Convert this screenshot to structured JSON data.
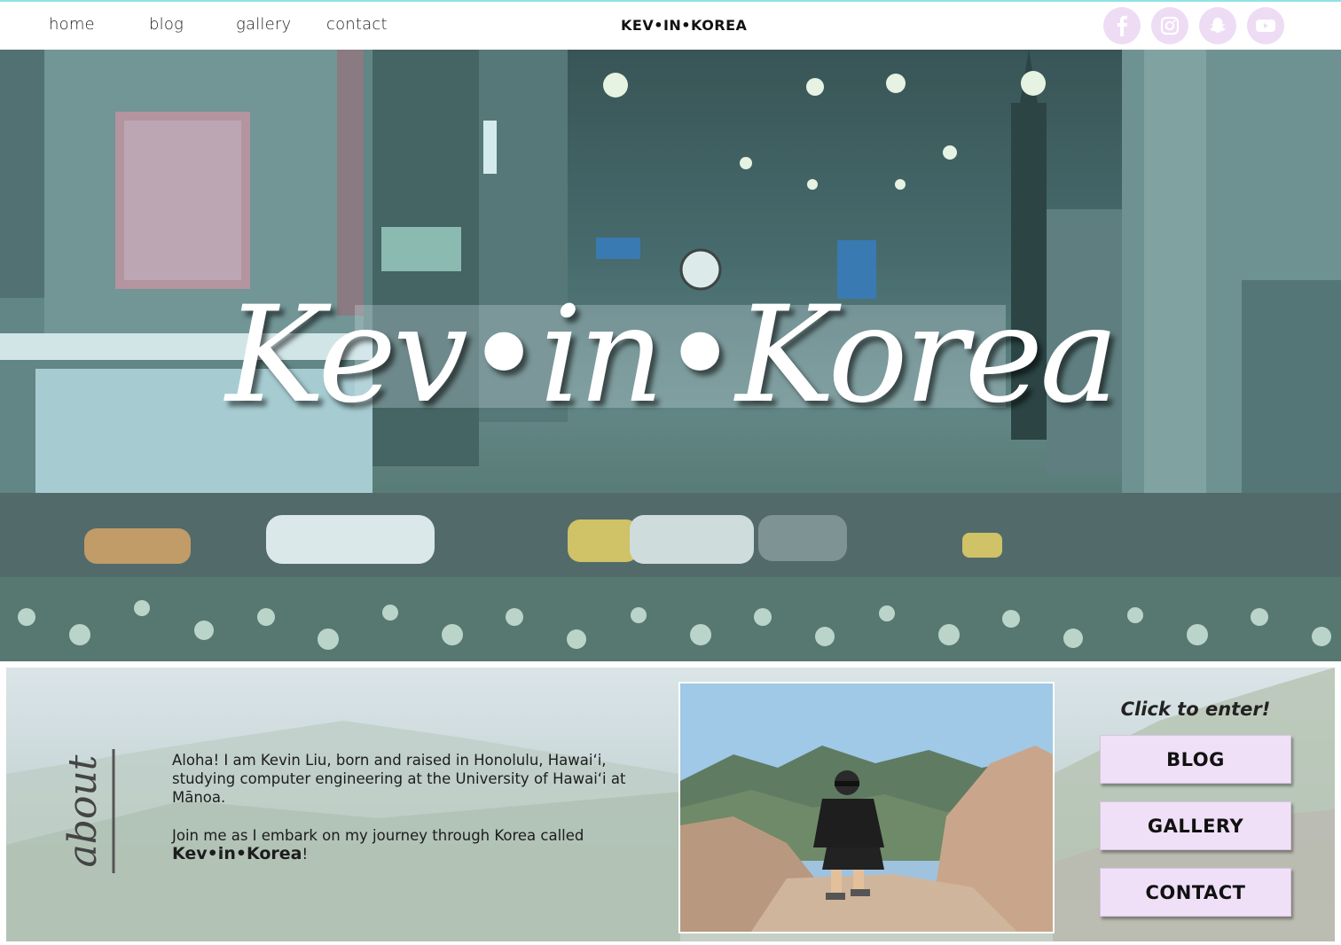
{
  "nav": {
    "links": [
      "home",
      "blog",
      "gallery",
      "contact"
    ],
    "brand": "KEV•IN•KOREA",
    "social_icons": [
      "facebook-icon",
      "instagram-icon",
      "snapchat-icon",
      "youtube-icon"
    ]
  },
  "hero": {
    "title": "Kev•in•Korea"
  },
  "about": {
    "heading": "about",
    "paragraph1": "Aloha! I am Kevin Liu, born and raised in Honolulu, Hawai‘i, studying computer engineering at the University of Hawai‘i at Mānoa.",
    "paragraph2_intro": "Join me as I embark on my journey through Korea called",
    "paragraph2_name": "Kev•in•Korea",
    "paragraph2_end": "!"
  },
  "enter": {
    "label": "Click to enter!",
    "buttons": [
      "BLOG",
      "GALLERY",
      "CONTACT"
    ]
  },
  "colors": {
    "accent_lavender": "#efe0f7",
    "social_bg": "#eedcf5",
    "top_line": "#8fe3e8"
  }
}
